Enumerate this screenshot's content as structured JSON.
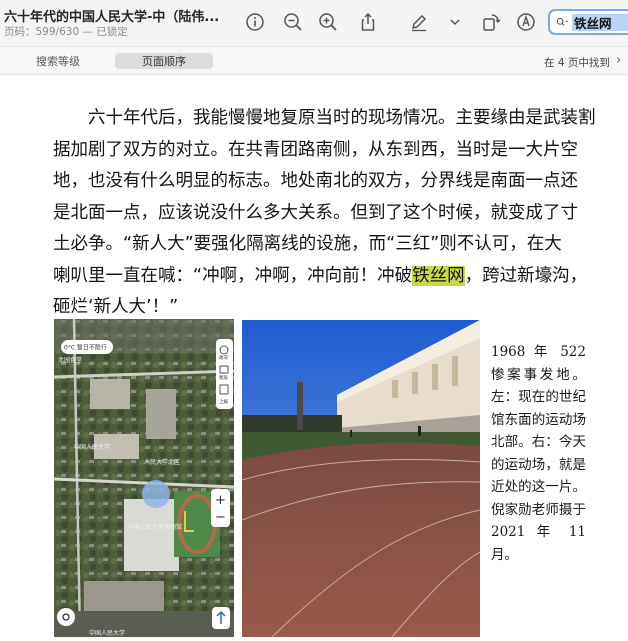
{
  "toolbar": {
    "doc_title": "六十年代的中国人民大学-中（陆伟...",
    "doc_subtitle": "页码：599/630 — 已锁定",
    "icons": [
      "info-icon",
      "zoom-out-icon",
      "zoom-in-icon",
      "share-icon",
      "highlight-pen-icon",
      "chevron-down-icon",
      "rotate-icon",
      "markup-icon",
      "search-icon"
    ],
    "search_value": "铁丝网"
  },
  "subbar": {
    "segments": [
      "搜索等级",
      "页面顺序"
    ],
    "active_segment": "页面顺序",
    "found_text": "在 4 页中找到"
  },
  "page": {
    "lines": [
      [
        "　　六十年代后，我能慢慢地复原当时的现场情况。主要缘由是武装割"
      ],
      [
        "据加剧了双方的对立。在共青团路南侧，从东到西，当时是一大片空"
      ],
      [
        "地，也没有什么明显的标志。地处南北的双方，分界线是南面一点还"
      ],
      [
        "是北面一点，应该说没什么多大关系。但到了这个时候，就变成了寸"
      ],
      [
        "土必争。“新人大”要强化隔离线的设施，而“三红”则不认可，在大"
      ],
      [
        "喇叭里一直在喊：“冲啊，冲啊，冲向前！冲破",
        "铁丝网",
        "，跨过新壕沟，"
      ],
      [
        "砸烂‘新人大’！”"
      ]
    ],
    "highlight_term": "铁丝网",
    "map_labels": {
      "weather": "0°C 暂日不限行",
      "district": "北园食堂",
      "uni1": "中国人民大学",
      "uni2": "人民大学北区",
      "museum": "中国人民大学博物馆",
      "footer": "中国人民大学",
      "side1": "路况",
      "side2": "图层",
      "side3": "上报"
    },
    "caption": "1968 年 522 惨案事发地。左：现在的世纪馆东面的运动场北部。右：今天的运动场，就是近处的这一片。倪家勋老师摄于 2021 年 11 月。"
  },
  "colors": {
    "highlight": "#c8d84a",
    "search_border": "#7aa7e8",
    "track": "#8b4a3e",
    "sky": "#2c68d6"
  }
}
